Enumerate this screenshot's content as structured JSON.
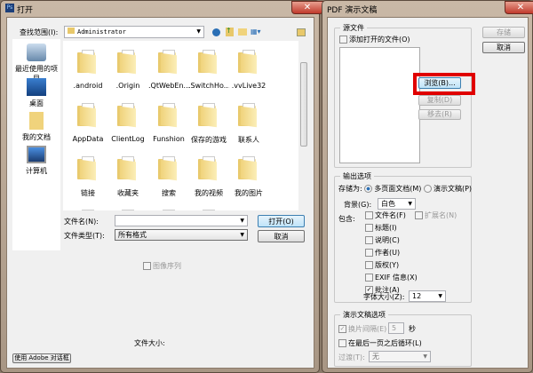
{
  "open_dialog": {
    "title": "打开",
    "look_in_label": "查找范围(I):",
    "look_in_value": "Administrator",
    "sidebar": [
      {
        "label": "最近使用的项目",
        "icon": "recent-icon"
      },
      {
        "label": "桌面",
        "icon": "desktop-icon"
      },
      {
        "label": "我的文档",
        "icon": "documents-icon"
      },
      {
        "label": "计算机",
        "icon": "computer-icon"
      }
    ],
    "files": [
      ".android",
      ".Origin",
      ".QtWebEn...",
      ".SwitchHo...",
      ".vvLive32",
      "AppData",
      "ClientLog",
      "Funshion",
      "保存的游戏",
      "联系人",
      "链接",
      "收藏夹",
      "搜索",
      "我的视频",
      "我的图片",
      "",
      "",
      "",
      ""
    ],
    "filename_label": "文件名(N):",
    "filename_value": "",
    "filetype_label": "文件类型(T):",
    "filetype_value": "所有格式",
    "open_button": "打开(O)",
    "cancel_button": "取消",
    "image_sequence": "图像序列",
    "file_size_label": "文件大小:",
    "adobe_button": "使用 Adobe 对话框"
  },
  "pdf_dialog": {
    "title": "PDF 演示文稿",
    "source_group": "源文件",
    "add_open_files": "添加打开的文件(O)",
    "browse_button": "浏览(B)...",
    "duplicate_button": "复制(D)",
    "remove_button": "移去(R)",
    "save_button": "存储",
    "cancel_button": "取消",
    "output_group": "输出选项",
    "save_as_label": "存储为:",
    "multi_page": "多页面文档(M)",
    "presentation": "演示文稿(P)",
    "background_label": "背景(G):",
    "background_value": "白色",
    "include_label": "包含:",
    "include": [
      {
        "label": "文件名(F)",
        "checked": false
      },
      {
        "label": "扩展名(N)",
        "checked": false,
        "disabled": true
      },
      {
        "label": "标题(I)",
        "checked": false
      },
      {
        "label": "说明(C)",
        "checked": false
      },
      {
        "label": "作者(U)",
        "checked": false
      },
      {
        "label": "版权(Y)",
        "checked": false
      },
      {
        "label": "EXIF 信息(X)",
        "checked": false
      },
      {
        "label": "批注(A)",
        "checked": true
      }
    ],
    "font_size_label": "字体大小(Z):",
    "font_size_value": "12",
    "presentation_group": "演示文稿选项",
    "advance_label": "换片间隔(E)",
    "advance_value": "5",
    "seconds": "秒",
    "loop_label": "在最后一页之后循环(L)",
    "transition_label": "过渡(T):",
    "transition_value": "无",
    "highlight_color": "#e00000"
  }
}
